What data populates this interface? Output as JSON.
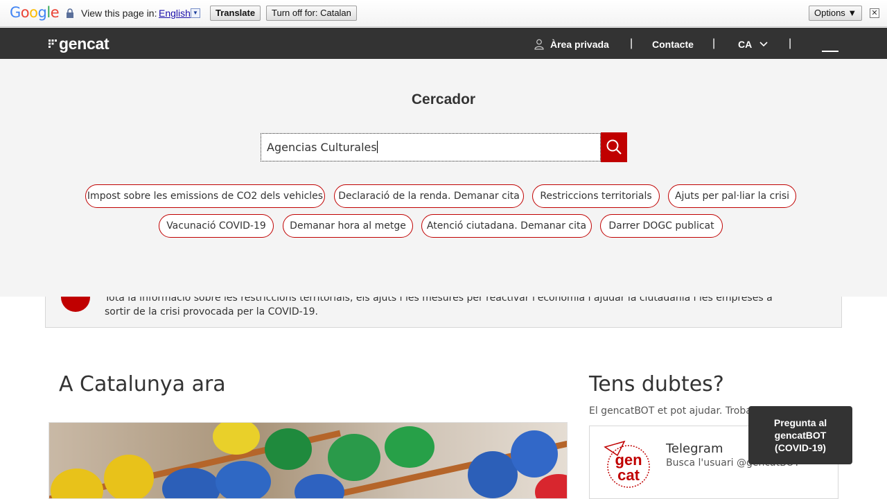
{
  "translate_bar": {
    "logo_text": "Google",
    "view_label": "View this page in:",
    "language_link": "English",
    "translate_button": "Translate",
    "turn_off_button": "Turn off for: Catalan",
    "options_button": "Options ▼",
    "close_glyph": "✕"
  },
  "header": {
    "logo": "gencat",
    "area_privada": "Àrea privada",
    "contacte": "Contacte",
    "language": "CA",
    "separator": "|"
  },
  "search": {
    "title": "Cercador",
    "query": "Agencias Culturales",
    "suggestions": [
      "Impost sobre les emissions de CO2 dels vehicles",
      "Declaració de la renda. Demanar cita",
      "Restriccions territorials",
      "Ajuts per pal·liar la crisi",
      "Vacunació COVID-19",
      "Demanar hora al metge",
      "Atenció ciutadana. Demanar cita",
      "Darrer DOGC publicat"
    ]
  },
  "covid_banner": {
    "text": "Tota la informació sobre les restriccions territorials, els ajuts i les mesures per reactivar l'economia i ajudar la ciutadania i les empreses a sortir de la crisi provocada per la COVID-19."
  },
  "left_section": {
    "title": "A Catalunya ara"
  },
  "right_section": {
    "title": "Tens dubtes?",
    "subtitle": "El gencatBOT et pot ajudar. Troba'l a",
    "telegram_title": "Telegram",
    "telegram_sub": "Busca l'usuari @gencatBOT",
    "telegram_logo_line1": "gen",
    "telegram_logo_line2": "cat"
  },
  "bot_tooltip": {
    "line1": "Pregunta al",
    "line2": "gencatBOT",
    "line3": "(COVID-19)"
  },
  "colors": {
    "accent_red": "#c00000",
    "header_dark": "#333333",
    "panel_bg": "#f4f4f4"
  }
}
